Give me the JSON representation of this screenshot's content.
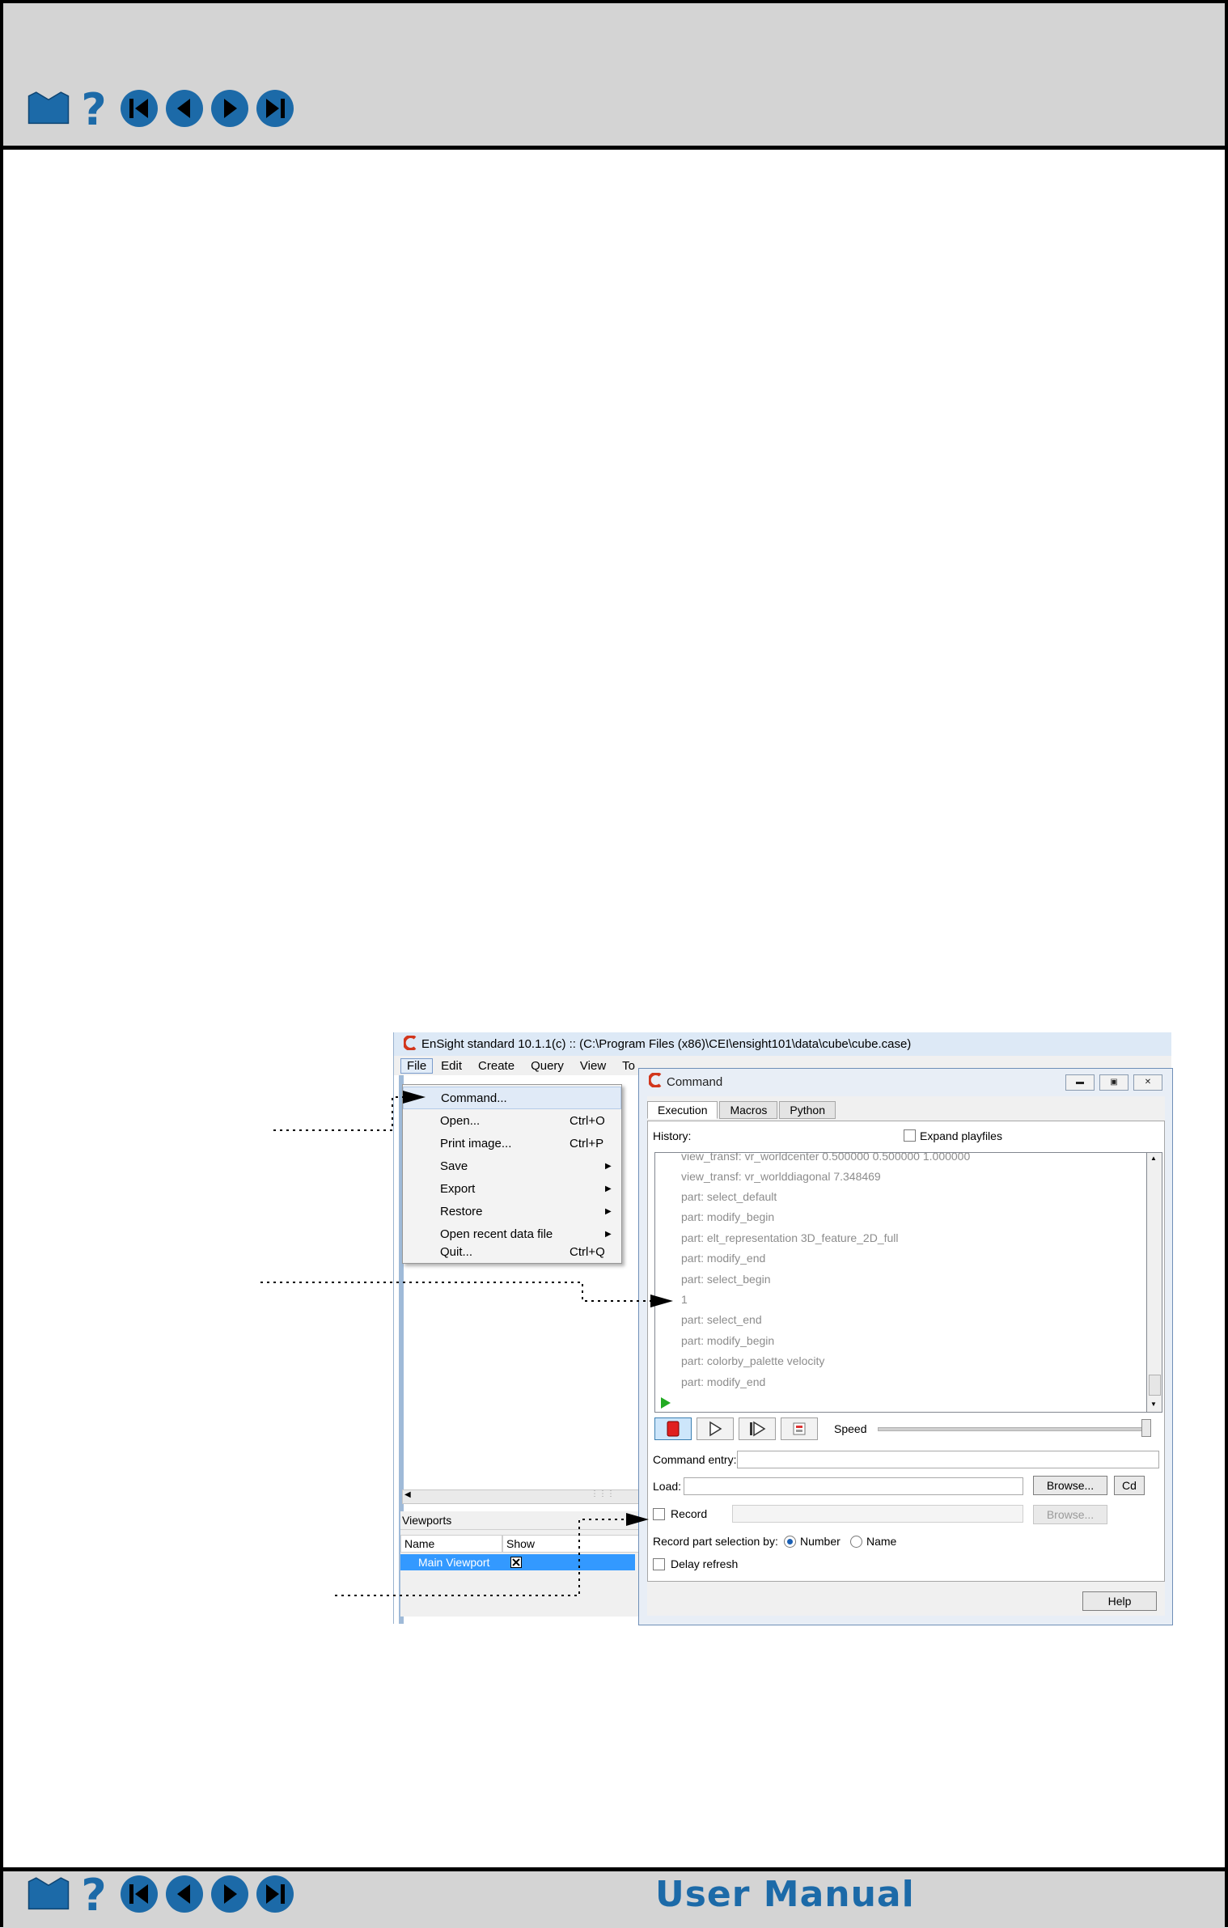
{
  "nav_icons": [
    "home-icon",
    "help-icon",
    "first-page-icon",
    "previous-page-icon",
    "next-page-icon",
    "last-page-icon"
  ],
  "footer": {
    "manual_title": "User Manual"
  },
  "main_window": {
    "title": "EnSight standard 10.1.1(c) ::  (C:\\Program Files (x86)\\CEI\\ensight101\\data\\cube\\cube.case)",
    "menu": [
      "File",
      "Edit",
      "Create",
      "Query",
      "View",
      "To"
    ],
    "file_menu": [
      {
        "label": "Command...",
        "shortcut": "",
        "submenu": false
      },
      {
        "label": "Open...",
        "shortcut": "Ctrl+O",
        "submenu": false
      },
      {
        "label": "Print image...",
        "shortcut": "Ctrl+P",
        "submenu": false
      },
      {
        "label": "Save",
        "shortcut": "",
        "submenu": true
      },
      {
        "label": "Export",
        "shortcut": "",
        "submenu": true
      },
      {
        "label": "Restore",
        "shortcut": "",
        "submenu": true
      },
      {
        "label": "Open recent data file",
        "shortcut": "",
        "submenu": true
      },
      {
        "label": "Quit...",
        "shortcut": "Ctrl+Q",
        "submenu": false
      }
    ],
    "viewports": {
      "header": "Viewports",
      "columns": [
        "Name",
        "Show"
      ],
      "row_name": "Main Viewport",
      "row_show": true
    }
  },
  "command_dialog": {
    "title": "Command",
    "tabs": [
      "Execution",
      "Macros",
      "Python"
    ],
    "history_label": "History:",
    "expand_playfiles": "Expand playfiles",
    "history": [
      "view_transf: vr_worldcenter 0.500000 0.500000 1.000000",
      "view_transf: vr_worlddiagonal 7.348469",
      "part: select_default",
      "part: modify_begin",
      "part: elt_representation 3D_feature_2D_full",
      "part: modify_end",
      "part: select_begin",
      " 1",
      "part: select_end",
      "part: modify_begin",
      "part: colorby_palette velocity",
      "part: modify_end"
    ],
    "speed_label": "Speed",
    "command_entry_label": "Command entry:",
    "command_entry_value": "",
    "load_label": "Load:",
    "load_value": "",
    "browse": "Browse...",
    "cd": "Cd",
    "record_label": "Record",
    "record_value": "",
    "record_selection_label": "Record part selection by:",
    "option_number": "Number",
    "option_name": "Name",
    "selected_option": "Number",
    "delay_refresh": "Delay refresh",
    "help": "Help",
    "colors": {
      "stop_button": "#e02020",
      "play_marker": "#22aa22"
    }
  }
}
